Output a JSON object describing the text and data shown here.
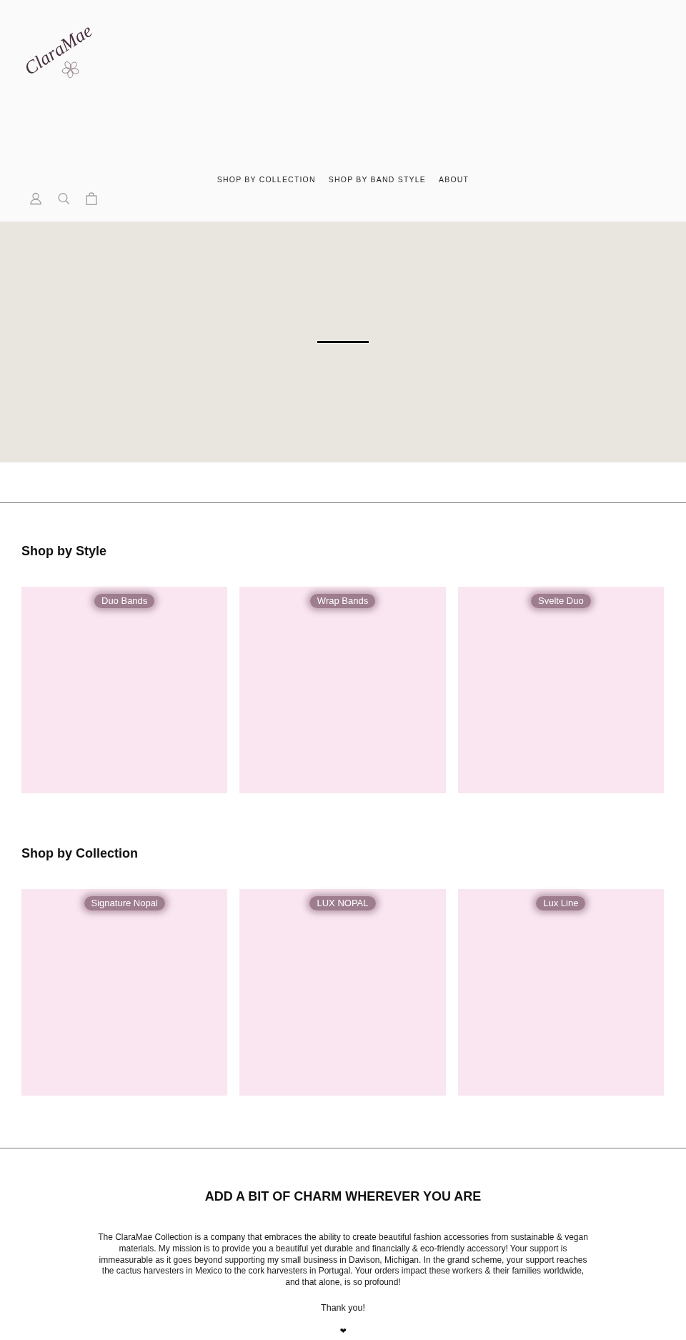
{
  "header": {
    "logo": "ClaraMae",
    "nav": [
      {
        "label": "SHOP BY COLLECTION"
      },
      {
        "label": "SHOP BY BAND STYLE"
      },
      {
        "label": "ABOUT"
      }
    ]
  },
  "sections": [
    {
      "title": "Shop by Style",
      "cards": [
        {
          "label": "Duo Bands"
        },
        {
          "label": "Wrap Bands"
        },
        {
          "label": "Svelte Duo"
        }
      ]
    },
    {
      "title": "Shop by Collection",
      "cards": [
        {
          "label": "Signature Nopal"
        },
        {
          "label": "LUX NOPAL"
        },
        {
          "label": "Lux Line"
        }
      ]
    }
  ],
  "about": {
    "title": "ADD A BIT OF CHARM WHEREVER YOU ARE",
    "text": "The ClaraMae Collection is a company that embraces the ability to create beautiful fashion accessories from sustainable & vegan materials. My mission is to provide you a beautiful yet durable and financially & eco-friendly accessory! Your support is immeasurable as it goes beyond supporting my small business in Davison, Michigan. In the grand scheme, your support reaches the cactus harvesters in Mexico to the cork harvesters in Portugal. Your orders impact these workers & their families worldwide, and that alone, is so profound!",
    "thanks": "Thank you!",
    "symbol": "❤"
  }
}
